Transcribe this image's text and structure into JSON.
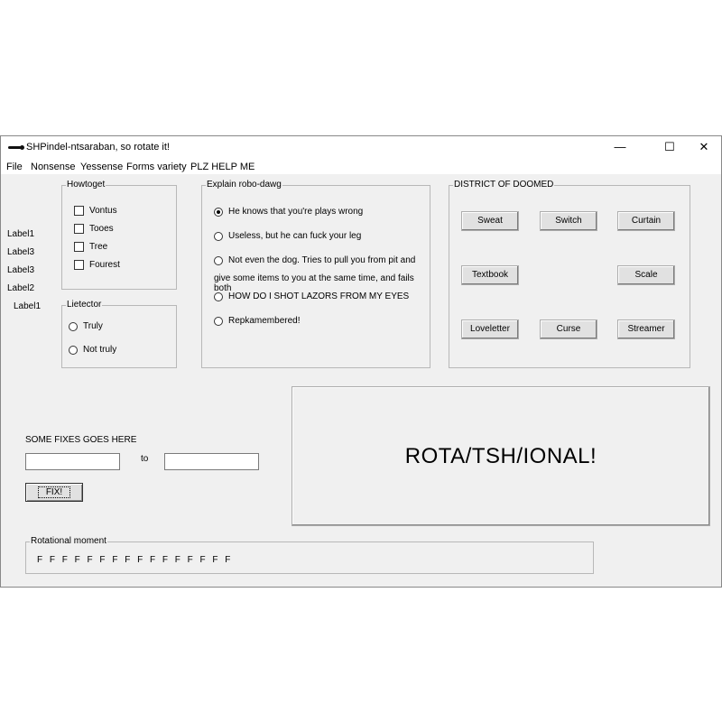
{
  "window": {
    "title": "SHPindel-ntsaraban, so rotate it!",
    "minimize": "—",
    "maximize": "☐",
    "close": "✕"
  },
  "menu": [
    {
      "label": "File"
    },
    {
      "label": "Nonsense"
    },
    {
      "label": "Yessense"
    },
    {
      "label": "Forms variety"
    },
    {
      "label": "PLZ HELP ME"
    }
  ],
  "left_labels": [
    "Label1",
    "Label3",
    "Label3",
    "Label2",
    "Label1"
  ],
  "howtoget": {
    "title": "Howtoget",
    "items": [
      "Vontus",
      "Tooes",
      "Tree",
      "Fourest"
    ]
  },
  "lietector": {
    "title": "Lietector",
    "options": [
      "Truly",
      "Not truly"
    ]
  },
  "explain": {
    "title": "Explain robo-dawg",
    "options": [
      "He knows that you're plays wrong",
      "Useless, but he can fuck your leg",
      "Not even the dog. Tries to pull you from pit and",
      "HOW DO I SHOT LAZORS FROM MY EYES",
      "Repkamembered!"
    ],
    "option3_line2": "give some items to you at the same time, and fails both",
    "selected_index": 0
  },
  "district": {
    "title": "DISTRICT OF DOOMED",
    "buttons": [
      "Sweat",
      "Switch",
      "Curtain",
      "Textbook",
      "Scale",
      "Loveletter",
      "Curse",
      "Streamer"
    ]
  },
  "fixes": {
    "label": "SOME FIXES GOES HERE",
    "to_label": "to",
    "from_value": "",
    "to_value": "",
    "button": "FIX!"
  },
  "big_panel": {
    "text": "ROTA/TSH/IONAL!"
  },
  "rotational": {
    "title": "Rotational moment",
    "letters": "F F F F F F F F F F F F F F F F"
  }
}
